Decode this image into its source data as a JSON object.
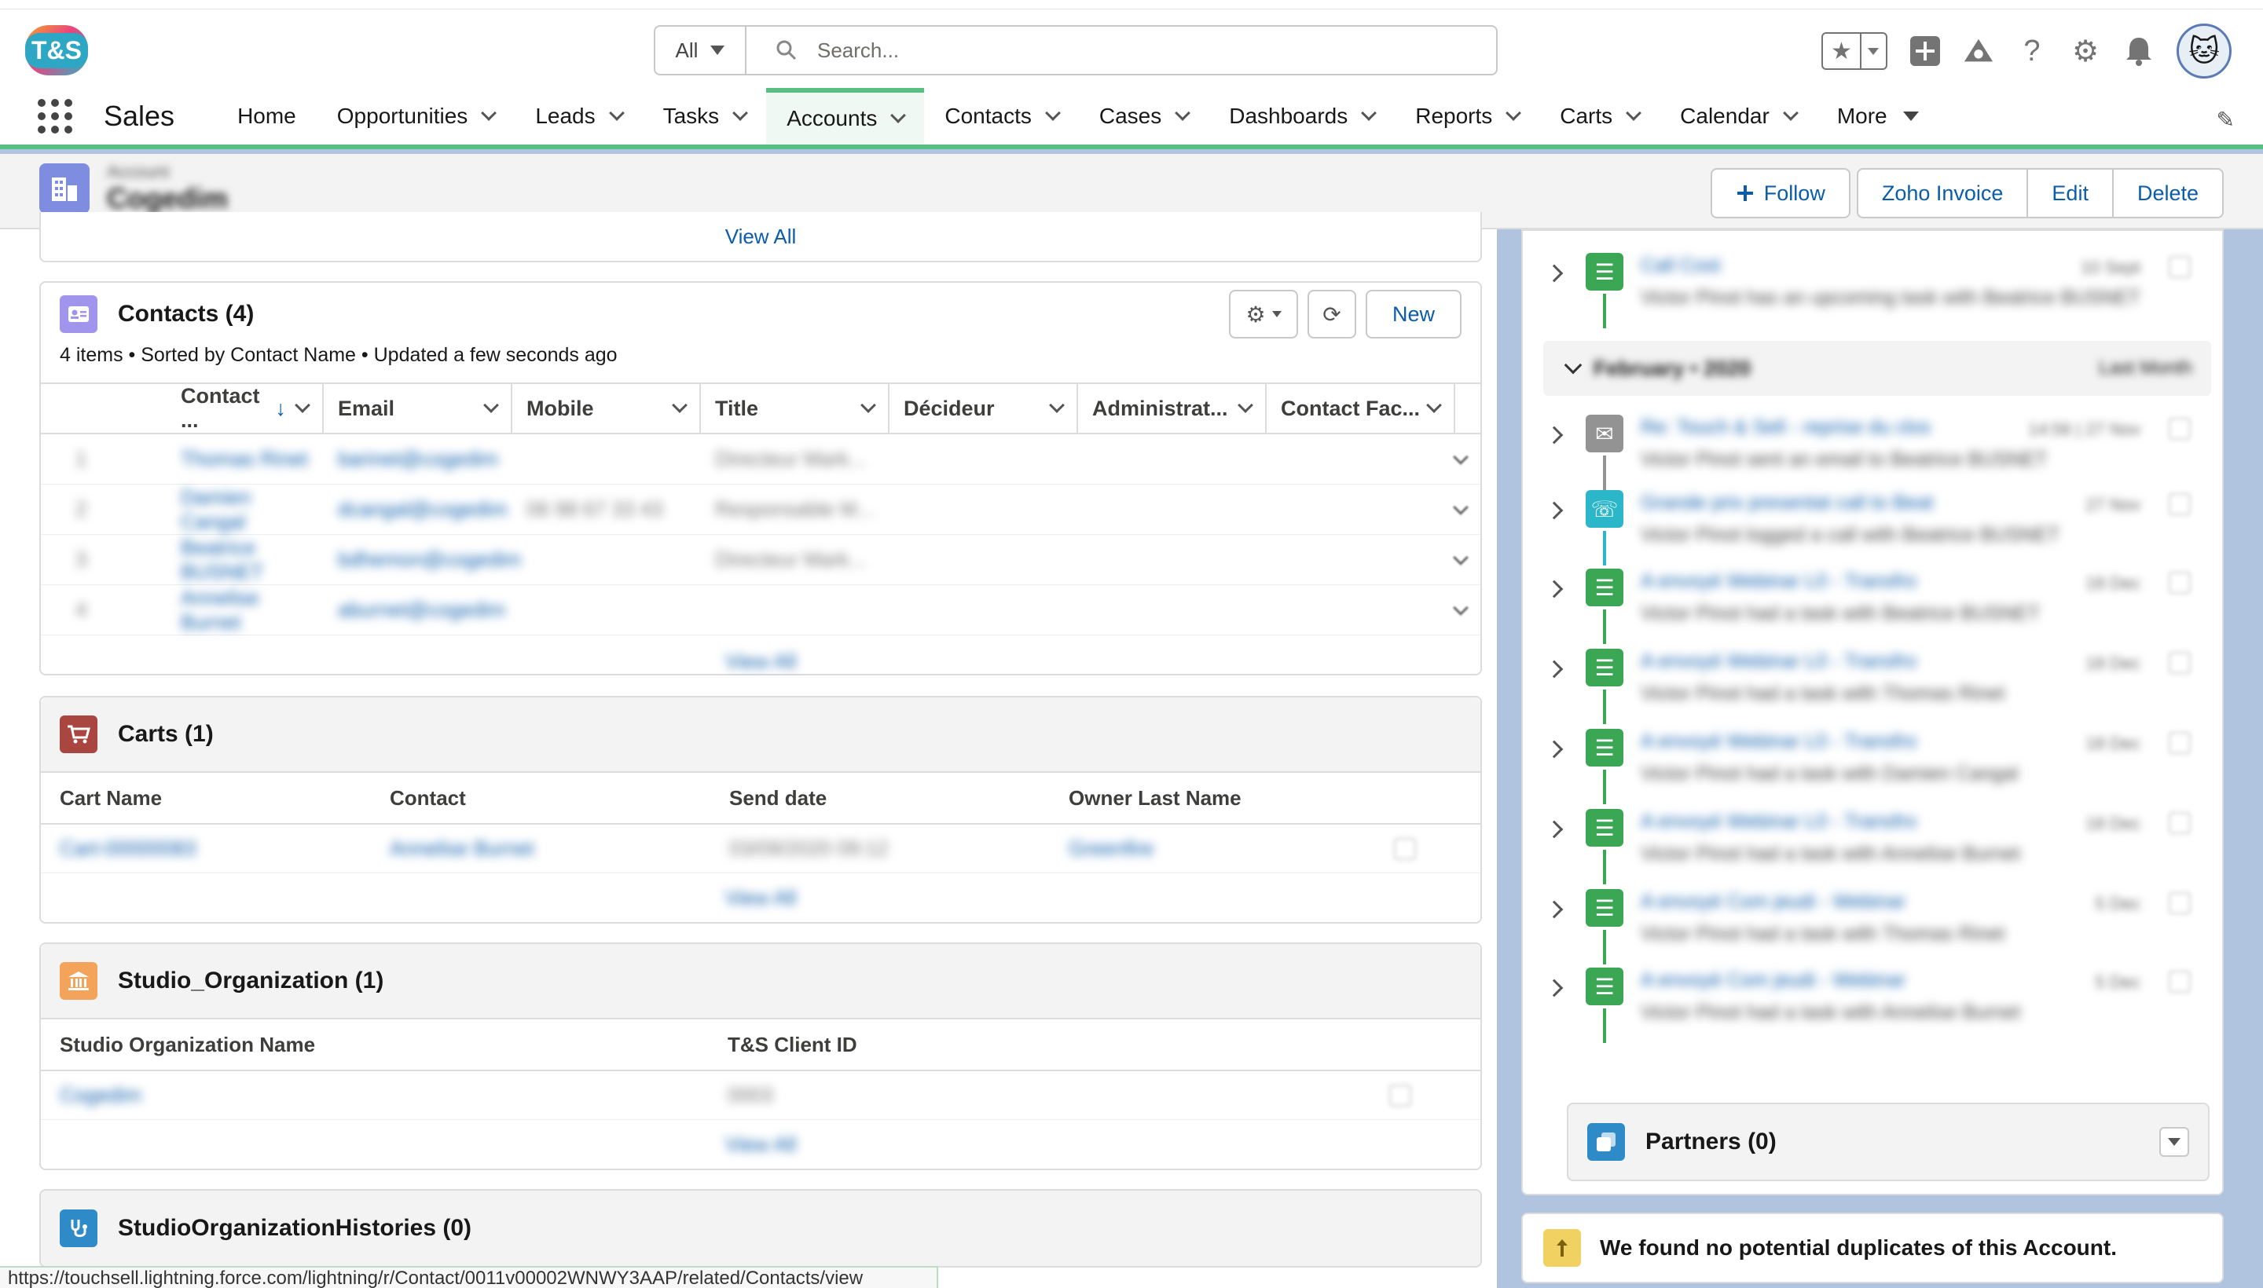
{
  "header": {
    "logo_text": "T&S",
    "search_scope": "All",
    "search_placeholder": "Search..."
  },
  "nav": {
    "app_name": "Sales",
    "items": [
      {
        "label": "Home",
        "has_menu": false
      },
      {
        "label": "Opportunities",
        "has_menu": true
      },
      {
        "label": "Leads",
        "has_menu": true
      },
      {
        "label": "Tasks",
        "has_menu": true
      },
      {
        "label": "Accounts",
        "has_menu": true,
        "active": true
      },
      {
        "label": "Contacts",
        "has_menu": true
      },
      {
        "label": "Cases",
        "has_menu": true
      },
      {
        "label": "Dashboards",
        "has_menu": true
      },
      {
        "label": "Reports",
        "has_menu": true
      },
      {
        "label": "Carts",
        "has_menu": true
      },
      {
        "label": "Calendar",
        "has_menu": true
      }
    ],
    "more_label": "More"
  },
  "record": {
    "object_label": "Account",
    "name": "Cogedim",
    "actions": {
      "follow": "Follow",
      "zoho": "Zoho Invoice",
      "edit": "Edit",
      "delete": "Delete"
    }
  },
  "top_card": {
    "view_all": "View All"
  },
  "contacts": {
    "title": "Contacts (4)",
    "meta": "4 items • Sorted by Contact Name • Updated a few seconds ago",
    "new_label": "New",
    "columns": [
      "Contact ...",
      "Email",
      "Mobile",
      "Title",
      "Décideur",
      "Administrat...",
      "Contact Fac..."
    ],
    "rows": [
      {
        "num": "1",
        "name": "Thomas Rinet",
        "email": "barinet@cogedim",
        "mobile": "",
        "title": "Directeur Mark..."
      },
      {
        "num": "2",
        "name": "Damien Cangal",
        "email": "dcangal@cogedim",
        "mobile": "06 98 67 33 43",
        "title": "Responsable M..."
      },
      {
        "num": "3",
        "name": "Beatrice BUSNET",
        "email": "bdhemon@cogedim",
        "mobile": "",
        "title": "Directeur Mark..."
      },
      {
        "num": "4",
        "name": "Annelise Burnet",
        "email": "aburnet@cogedim",
        "mobile": "",
        "title": ""
      }
    ],
    "view_all": "View All"
  },
  "carts": {
    "title": "Carts (1)",
    "columns": [
      "Cart Name",
      "Contact",
      "Send date",
      "Owner Last Name"
    ],
    "rows": [
      {
        "name": "Cart-00000083",
        "contact": "Annelise Burnet",
        "send_date": "03/09/2020 09:12",
        "owner": "Greenfire"
      }
    ],
    "view_all": "View All"
  },
  "studio": {
    "title": "Studio_Organization (1)",
    "columns": [
      "Studio Organization Name",
      "T&S Client ID"
    ],
    "rows": [
      {
        "name": "Cogedim",
        "client_id": "0003"
      }
    ],
    "view_all": "View All"
  },
  "histories": {
    "title": "StudioOrganizationHistories (0)"
  },
  "activity": {
    "first_item": {
      "subject": "Call Cost",
      "desc": "Victor Pinot has an upcoming task with Beatrice BUSNET",
      "date": "10 Sept"
    },
    "month_label": "February • 2020",
    "month_right": "Last Month",
    "items": [
      {
        "icon": "email",
        "subject": "Re: Touch & Sell - reprise du clos",
        "desc": "Victor Pinot sent an email to Beatrice BUSNET",
        "date": "14:56 | 27 Nov"
      },
      {
        "icon": "call",
        "subject": "Grande prix presentat call to Beat",
        "desc": "Victor Pinot logged a call with Beatrice BUSNET",
        "date": "27 Nov"
      },
      {
        "icon": "task",
        "subject": "A envoyé Webinar L0 - Transfro",
        "desc": "Victor Pinot had a task with Beatrice BUSNET",
        "date": "18 Dec"
      },
      {
        "icon": "task",
        "subject": "A envoyé Webinar L0 - Transfro",
        "desc": "Victor Pinot had a task with Thomas Rinet",
        "date": "18 Dec"
      },
      {
        "icon": "task",
        "subject": "A envoyé Webinar L0 - Transfro",
        "desc": "Victor Pinot had a task with Damien Cangal",
        "date": "18 Dec"
      },
      {
        "icon": "task",
        "subject": "A envoyé Webinar L0 - Transfro",
        "desc": "Victor Pinot had a task with Annelise Burnet",
        "date": "18 Dec"
      },
      {
        "icon": "task",
        "subject": "A envoyé Com jeudi - Webinar",
        "desc": "Victor Pinot had a task with Thomas Rinet",
        "date": "5 Dec"
      },
      {
        "icon": "task",
        "subject": "A envoyé Com jeudi - Webinar",
        "desc": "Victor Pinot had a task with Annelise Burnet",
        "date": "5 Dec"
      }
    ]
  },
  "partners": {
    "title": "Partners (0)"
  },
  "duplicates": {
    "message": "We found no potential duplicates of this Account."
  },
  "status_url": "https://touchsell.lightning.force.com/lightning/r/Contact/0011v00002WNWY3AAP/related/Contacts/view"
}
